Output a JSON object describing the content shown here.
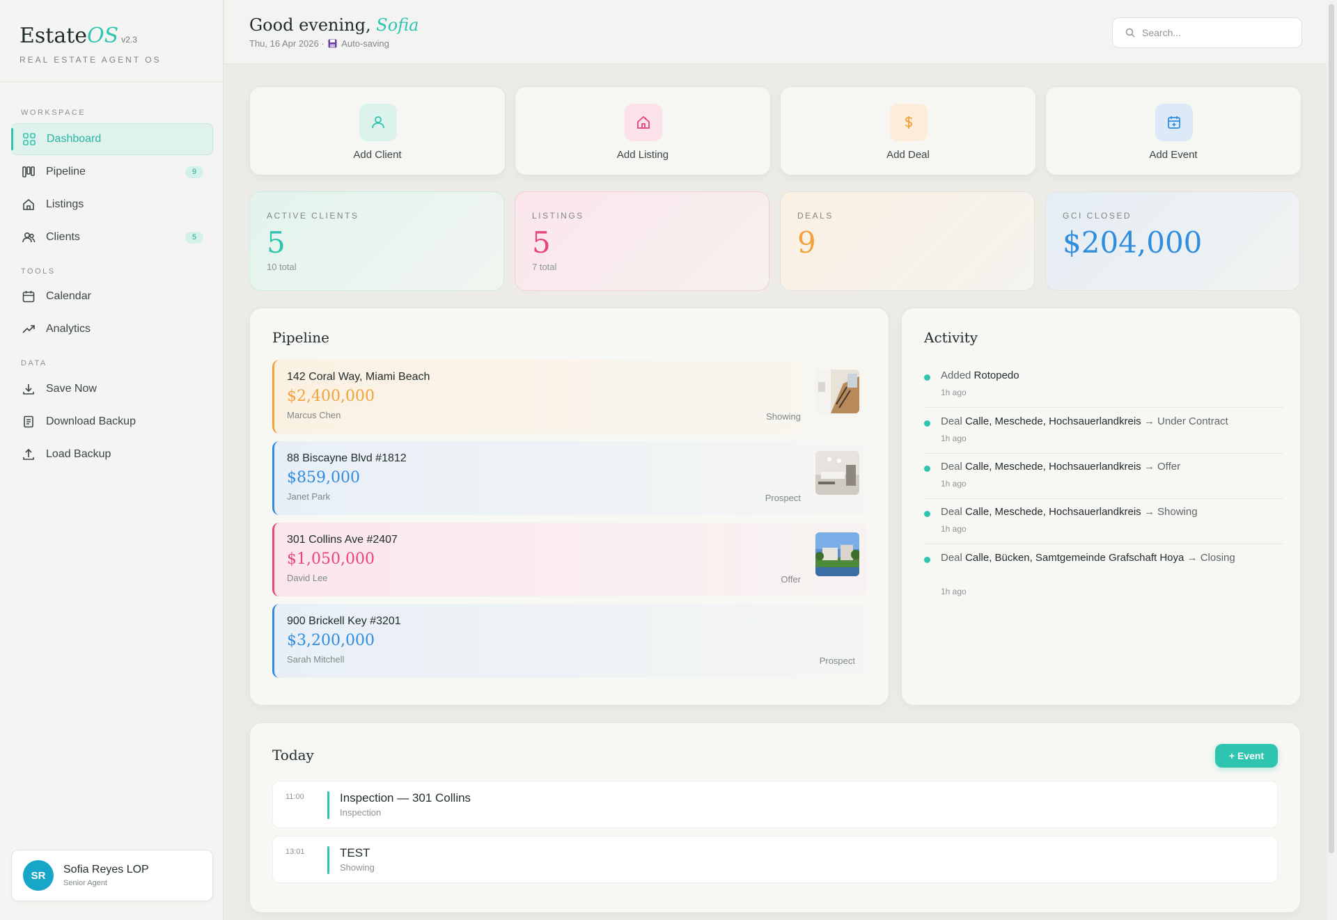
{
  "brand": {
    "name": "Estate",
    "accent": "OS",
    "version": "v2.3",
    "tagline": "REAL ESTATE AGENT OS"
  },
  "sidebar": {
    "sections": {
      "workspace": "WORKSPACE",
      "tools": "TOOLS",
      "data": "DATA"
    },
    "items": [
      {
        "label": "Dashboard",
        "icon": "grid-icon",
        "active": true
      },
      {
        "label": "Pipeline",
        "icon": "pipeline-icon",
        "badge": "9"
      },
      {
        "label": "Listings",
        "icon": "home-icon"
      },
      {
        "label": "Clients",
        "icon": "users-icon",
        "badge": "5"
      },
      {
        "label": "Calendar",
        "icon": "calendar-icon"
      },
      {
        "label": "Analytics",
        "icon": "trend-icon"
      },
      {
        "label": "Save Now",
        "icon": "download-icon"
      },
      {
        "label": "Download Backup",
        "icon": "document-icon"
      },
      {
        "label": "Load Backup",
        "icon": "upload-icon"
      }
    ]
  },
  "user": {
    "initials": "SR",
    "name": "Sofia Reyes LOP",
    "role": "Senior Agent"
  },
  "header": {
    "greeting": "Good evening,",
    "name": "Sofia",
    "date": "Thu, 16 Apr 2026 ·",
    "save_status": "Auto-saving",
    "search_placeholder": "Search..."
  },
  "quick_actions": [
    {
      "label": "Add Client",
      "icon": "user-icon",
      "color": "#2ec4b0"
    },
    {
      "label": "Add Listing",
      "icon": "house-icon",
      "color": "#e8457a"
    },
    {
      "label": "Add Deal",
      "icon": "dollar-icon",
      "color": "#f2a23a"
    },
    {
      "label": "Add Event",
      "icon": "calendar-plus-icon",
      "color": "#2f8de0"
    }
  ],
  "stats": [
    {
      "label": "ACTIVE CLIENTS",
      "value": "5",
      "sub": "10 total",
      "color": "#2ec4b0"
    },
    {
      "label": "LISTINGS",
      "value": "5",
      "sub": "7 total",
      "color": "#e8457a"
    },
    {
      "label": "DEALS",
      "value": "9",
      "sub": "",
      "color": "#f2a23a"
    },
    {
      "label": "GCI CLOSED",
      "value": "$204,000",
      "sub": "",
      "color": "#2f8de0"
    }
  ],
  "pipeline": {
    "title": "Pipeline",
    "deals": [
      {
        "address": "142 Coral Way, Miami Beach",
        "price": "$2,400,000",
        "agent": "Marcus Chen",
        "stage": "Showing",
        "color": "#f2a23a"
      },
      {
        "address": "88 Biscayne Blvd #1812",
        "price": "$859,000",
        "agent": "Janet Park",
        "stage": "Prospect",
        "color": "#2f8de0"
      },
      {
        "address": "301 Collins Ave #2407",
        "price": "$1,050,000",
        "agent": "David Lee",
        "stage": "Offer",
        "color": "#e8457a"
      },
      {
        "address": "900 Brickell Key #3201",
        "price": "$3,200,000",
        "agent": "Sarah Mitchell",
        "stage": "Prospect",
        "color": "#2f8de0"
      }
    ]
  },
  "activity": {
    "title": "Activity",
    "items": [
      {
        "prefix": "Added",
        "subject": "Rotopedo",
        "suffix": "",
        "time": "1h ago"
      },
      {
        "prefix": "Deal",
        "subject": "Calle, Meschede, Hochsauerlandkreis",
        "suffix": "→ Under Contract",
        "time": "1h ago"
      },
      {
        "prefix": "Deal",
        "subject": "Calle, Meschede, Hochsauerlandkreis",
        "suffix": "→ Offer",
        "time": "1h ago"
      },
      {
        "prefix": "Deal",
        "subject": "Calle, Meschede, Hochsauerlandkreis",
        "suffix": "→ Showing",
        "time": "1h ago"
      },
      {
        "prefix": "Deal",
        "subject": "Calle, Bücken, Samtgemeinde Grafschaft Hoya",
        "suffix": "→ Closing",
        "time": "1h ago"
      }
    ]
  },
  "today": {
    "title": "Today",
    "add_button": "+ Event",
    "events": [
      {
        "time": "11:00",
        "title": "Inspection — 301 Collins",
        "type": "Inspection"
      },
      {
        "time": "13:01",
        "title": "TEST",
        "type": "Showing"
      }
    ]
  }
}
